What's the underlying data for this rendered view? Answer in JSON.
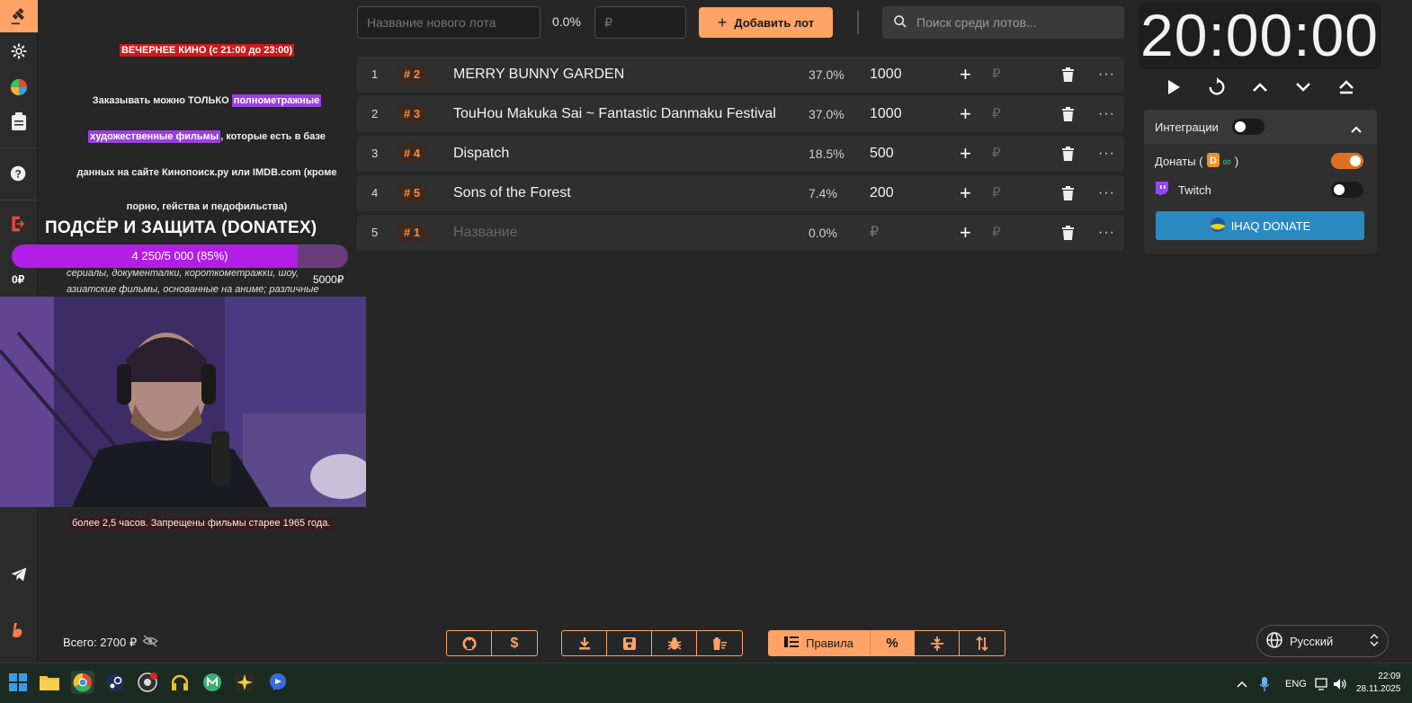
{
  "sidebar": {
    "icons": [
      "gavel-icon",
      "gear-icon",
      "pie-chart-icon",
      "clipboard-icon",
      "help-icon",
      "logout-icon",
      "telegram-icon",
      "brand-icon"
    ]
  },
  "rules_overlay": {
    "line1": "ВЕЧЕРНЕЕ КИНО (с 21:00 до 23:00)",
    "line2a": "Заказывать можно ТОЛЬКО ",
    "line2b": "полнометражные",
    "line3a": "художественные фильмы",
    "line3b": ", которые есть в базе",
    "line4": "данных на сайте Кинопоиск.ру или IMDB.com (кроме",
    "line5": "порно, гейства и педофильства)",
    "italic1": "сериалы, документалки, короткометражки, шоу,",
    "italic2": "азиатские фильмы, основанные на аниме; различные",
    "bottom": "более 2,5 часов. Запрещены фильмы старее 1965 года."
  },
  "goal": {
    "title": "ПОДСЁР И ЗАЩИТА (DONATEX)",
    "progress_text": "4 250/5 000 (85%)",
    "progress_fraction": 0.85,
    "min_label": "0₽",
    "max_label": "5000₽"
  },
  "total": {
    "label": "Всего: 2700 ₽"
  },
  "topbar": {
    "new_lot_placeholder": "Название нового лота",
    "percent": "0.0%",
    "amount_placeholder": "₽",
    "add_label": "Добавить лот",
    "search_placeholder": "Поиск среди лотов..."
  },
  "lots": [
    {
      "index": "1",
      "badge": "# 2",
      "name": "MERRY BUNNY GARDEN",
      "percent": "37.0%",
      "amount": "1000",
      "placeholder": false
    },
    {
      "index": "2",
      "badge": "# 3",
      "name": "TouHou Makuka Sai ~ Fantastic Danmaku Festival",
      "percent": "37.0%",
      "amount": "1000",
      "placeholder": false
    },
    {
      "index": "3",
      "badge": "# 4",
      "name": "Dispatch",
      "percent": "18.5%",
      "amount": "500",
      "placeholder": false
    },
    {
      "index": "4",
      "badge": "# 5",
      "name": " Sons of the Forest",
      "percent": "7.4%",
      "amount": "200",
      "placeholder": false
    },
    {
      "index": "5",
      "badge": "# 1",
      "name": "Название",
      "percent": "0.0%",
      "amount": "₽",
      "placeholder": true
    }
  ],
  "lot_controls": {
    "plus": "+",
    "rub": "₽",
    "more": "···"
  },
  "timer": {
    "value": "20:00:00"
  },
  "integrations": {
    "title": "Интеграции",
    "donations_label": "Донаты (",
    "donations_suffix": " )",
    "twitch_label": "Twitch",
    "ihaq_label": "IHAQ DONATE"
  },
  "toolbar": {
    "rules_label": "Правила",
    "percent_symbol": "%"
  },
  "language": {
    "selected": "Русский"
  },
  "taskbar": {
    "lang": "ENG",
    "time": "22:09",
    "date": "28.11.2025"
  },
  "colors": {
    "accent": "#ffa366",
    "goal_fill": "#b21ee6",
    "badge": "#ff8a3d",
    "ihaq": "#2a8ac0"
  }
}
